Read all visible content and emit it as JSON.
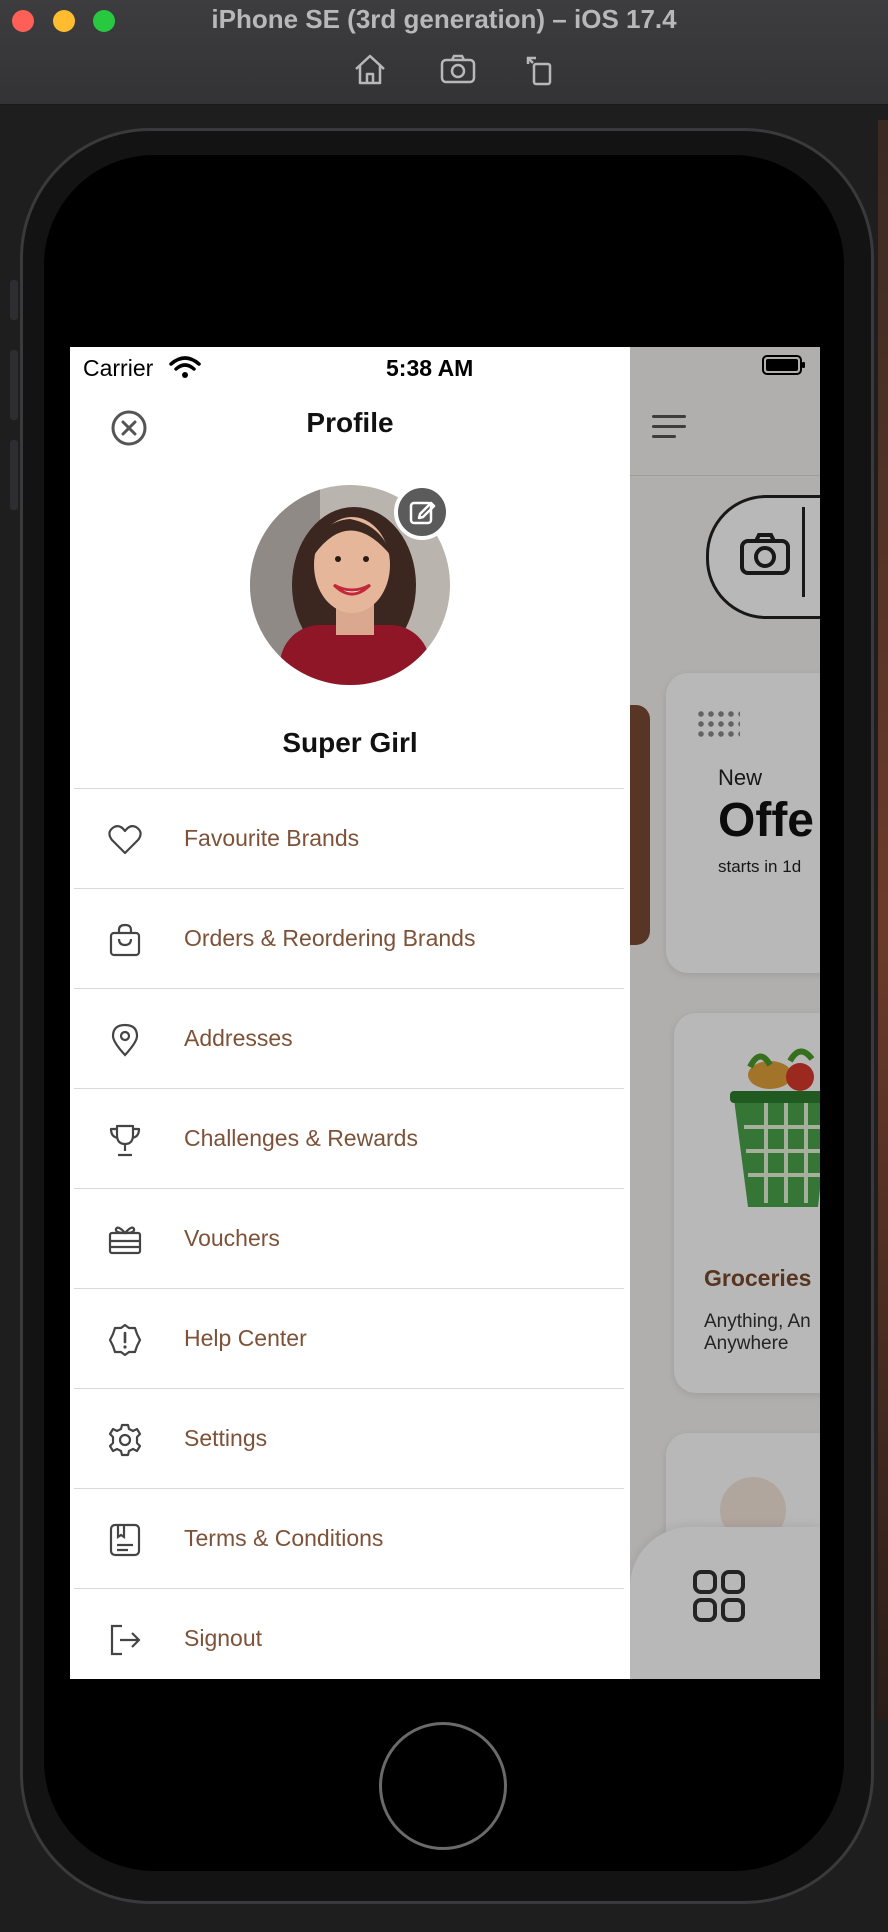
{
  "window": {
    "title": "iPhone SE (3rd generation) – iOS 17.4",
    "toolbar": [
      "home-icon",
      "screenshot-icon",
      "rotate-icon"
    ]
  },
  "status_bar": {
    "carrier": "Carrier",
    "time": "5:38 AM"
  },
  "drawer": {
    "title": "Profile",
    "user_name": "Super Girl",
    "menu": [
      {
        "label": "Favourite Brands",
        "icon": "heart-icon"
      },
      {
        "label": "Orders & Reordering Brands",
        "icon": "shopping-bag-icon"
      },
      {
        "label": "Addresses",
        "icon": "location-pin-icon"
      },
      {
        "label": "Challenges & Rewards",
        "icon": "trophy-icon"
      },
      {
        "label": "Vouchers",
        "icon": "gift-card-icon"
      },
      {
        "label": "Help Center",
        "icon": "help-alert-icon"
      },
      {
        "label": "Settings",
        "icon": "gear-icon"
      },
      {
        "label": "Terms & Conditions",
        "icon": "document-icon"
      },
      {
        "label": "Signout",
        "icon": "logout-icon"
      }
    ],
    "colors": {
      "menu_text": "#7d5238"
    }
  },
  "background_app": {
    "offer": {
      "kicker": "New",
      "title": "Offe",
      "subtitle": "starts in 1d"
    },
    "groceries": {
      "title": "Groceries",
      "description": "Anything, An Anywhere"
    },
    "colors": {
      "accent": "#7b4a2e",
      "brown_card": "#7a4a33"
    }
  }
}
